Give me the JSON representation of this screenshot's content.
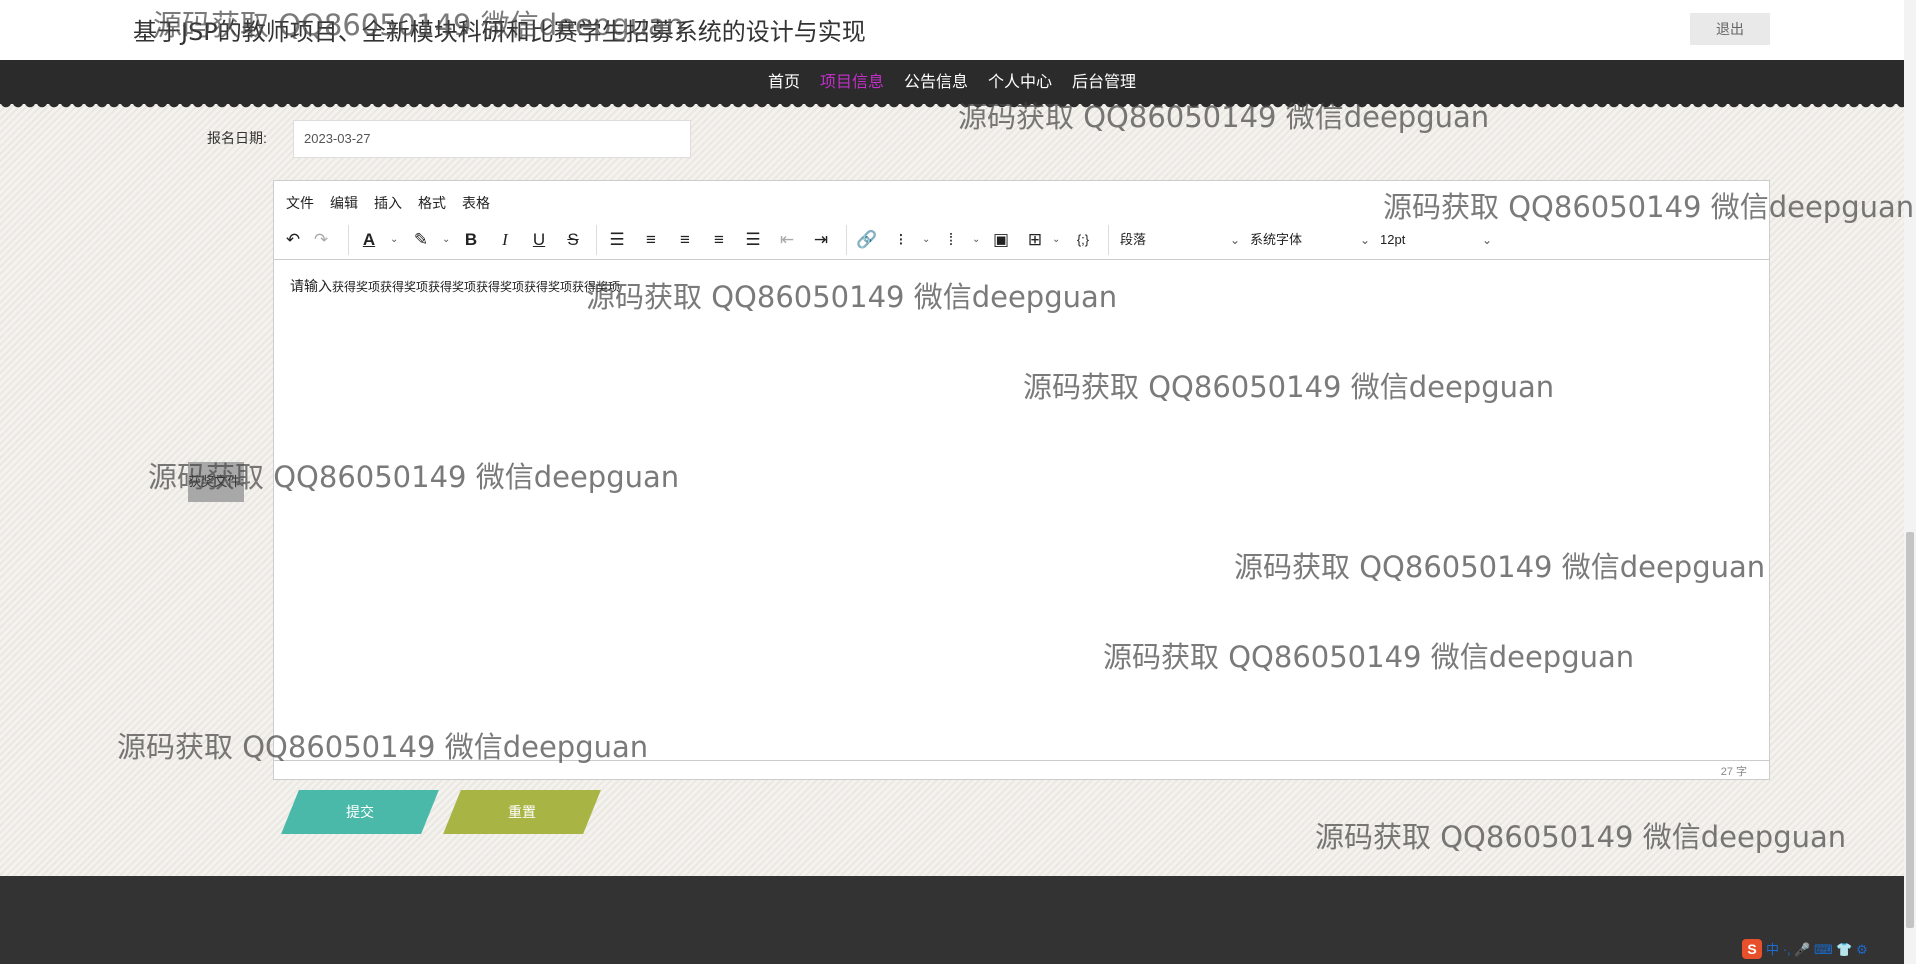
{
  "header": {
    "title": "基于JSP的教师项目、全新模块科研和比赛学生招募系统的设计与实现",
    "logout": "退出"
  },
  "nav": {
    "items": [
      "首页",
      "项目信息",
      "公告信息",
      "个人中心",
      "后台管理"
    ],
    "active": "项目信息"
  },
  "form": {
    "date_label": "报名日期:",
    "date_value": "2023-03-27",
    "editor": {
      "menu": [
        "文件",
        "编辑",
        "插入",
        "格式",
        "表格"
      ],
      "paragraph_select": "段落",
      "font_select": "系统字体",
      "size_select": "12pt",
      "content_prefix": "请输入",
      "content_text": "获得奖项获得奖项获得奖项获得奖项获得奖项获得奖项",
      "word_count": "27 字"
    },
    "side_label": "获奖文件:",
    "submit": "提交",
    "reset": "重置"
  },
  "watermark": "源码获取 QQ86050149 微信deepguan",
  "ime": {
    "logo": "S",
    "text": "中 ·, 🎤 ⌨ 👕 ⚙"
  }
}
